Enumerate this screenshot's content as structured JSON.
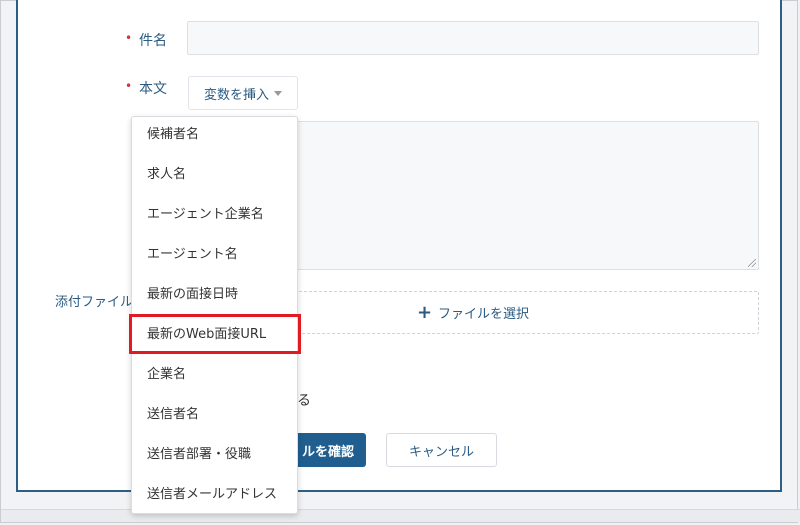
{
  "form": {
    "subject_label": "件名",
    "body_label": "本文",
    "required_mark": "•",
    "insert_variable_label": "変数を挿入",
    "attachment_label": "添付ファイル",
    "file_select_label": "ファイルを選択",
    "plus_glyph": "+",
    "option_text_tail": "る",
    "confirm_button_label": "ルを確認",
    "cancel_button_label": "キャンセル"
  },
  "variable_menu": {
    "items": [
      "候補者名",
      "求人名",
      "エージェント企業名",
      "エージェント名",
      "最新の面接日時",
      "最新のWeb面接URL",
      "企業名",
      "送信者名",
      "送信者部署・役職",
      "送信者メールアドレス"
    ],
    "highlighted_index": 5
  },
  "colors": {
    "accent": "#2b5b82",
    "primary_button": "#1f5e8e",
    "required": "#d0343d",
    "highlight_border": "#e11b22"
  }
}
